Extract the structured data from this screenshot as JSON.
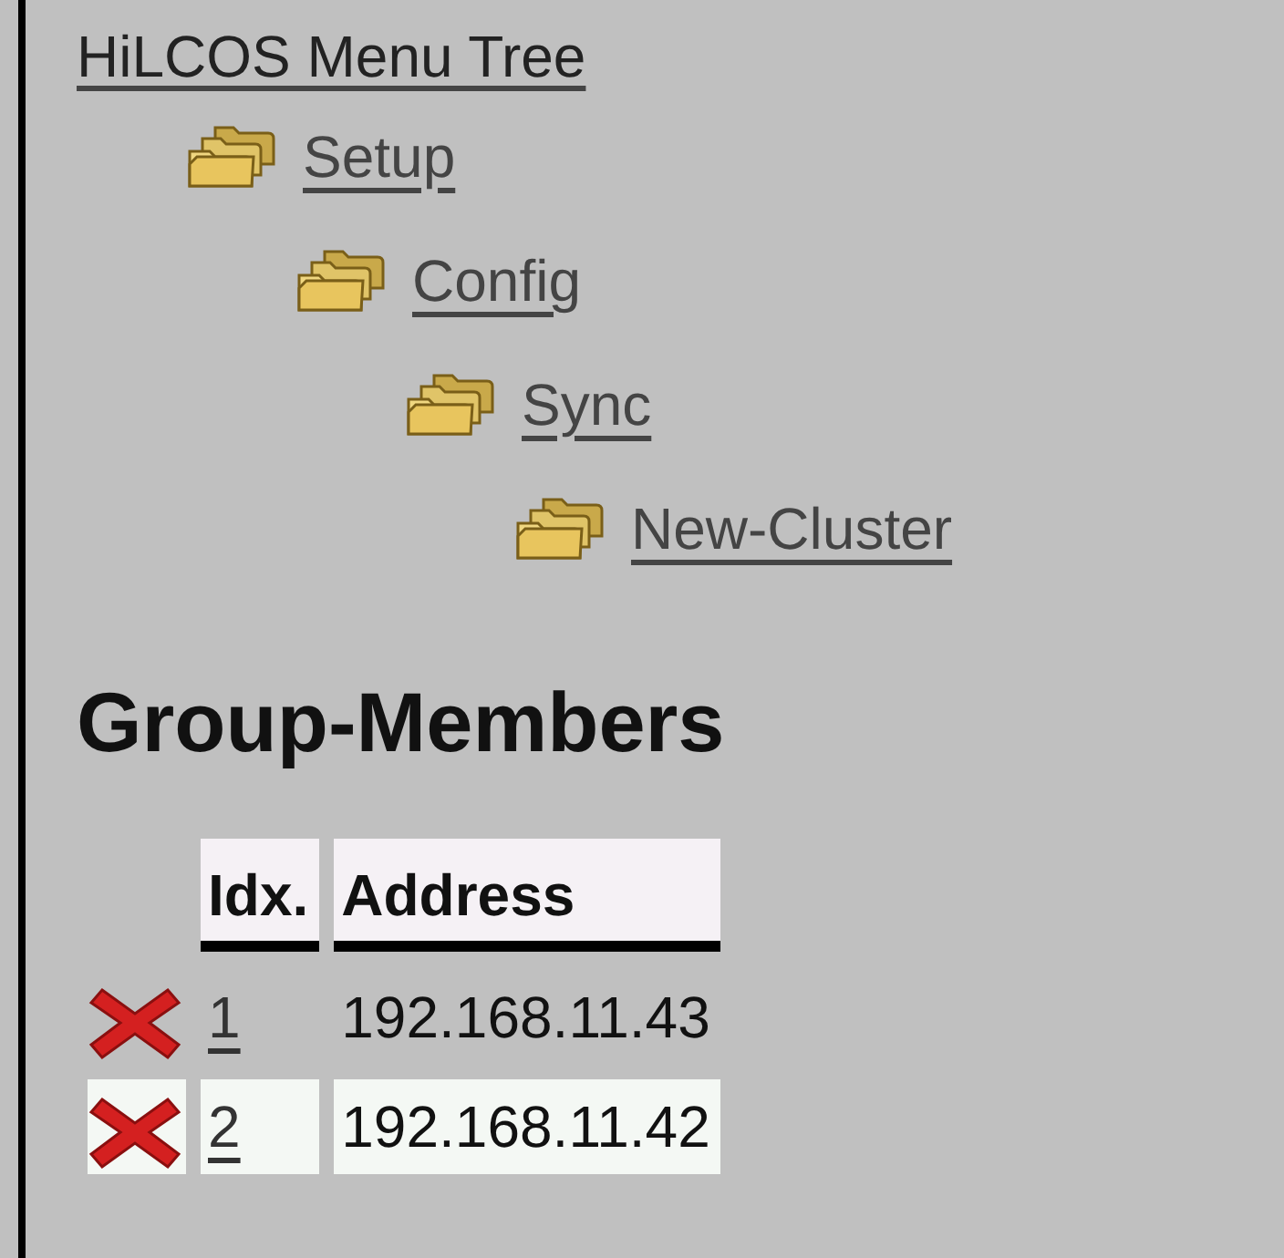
{
  "menu_tree": {
    "title": "HiLCOS Menu Tree",
    "items": [
      {
        "label": "Setup",
        "children": [
          {
            "label": "Config",
            "children": [
              {
                "label": "Sync",
                "children": [
                  {
                    "label": "New-Cluster"
                  }
                ]
              }
            ]
          }
        ]
      }
    ]
  },
  "heading": "Group-Members",
  "table": {
    "columns": [
      "Idx.",
      "Address"
    ],
    "rows": [
      {
        "idx": "1",
        "address": "192.168.11.43"
      },
      {
        "idx": "2",
        "address": "192.168.11.42"
      }
    ]
  }
}
